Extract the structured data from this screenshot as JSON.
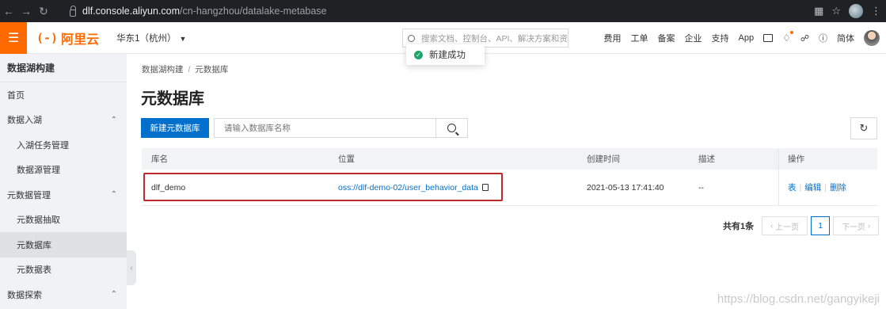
{
  "browser": {
    "domain": "dlf.console.aliyun.com",
    "path": "/cn-hangzhou/datalake-metabase",
    "icons": [
      "back-arrow-icon",
      "forward-arrow-icon",
      "reload-icon",
      "lock-icon",
      "qr-icon",
      "star-icon",
      "profile-icon",
      "menu-dots-icon"
    ]
  },
  "topbar": {
    "brand": "阿里云",
    "brand_mark": "(-)",
    "region": "华东1（杭州）",
    "search_placeholder": "搜索文档、控制台、API、解决方案和资",
    "nav": [
      "费用",
      "工单",
      "备案",
      "企业",
      "支持",
      "App"
    ],
    "lang": "简体",
    "accent_color": "#ff6a00"
  },
  "toast": {
    "message": "新建成功",
    "status_color": "#1ea56b"
  },
  "sidebar": {
    "title": "数据湖构建",
    "items": [
      {
        "label": "首页",
        "level": 0
      },
      {
        "label": "数据入湖",
        "level": 0,
        "expanded": true
      },
      {
        "label": "入湖任务管理",
        "level": 1
      },
      {
        "label": "数据源管理",
        "level": 1
      },
      {
        "label": "元数据管理",
        "level": 0,
        "expanded": true
      },
      {
        "label": "元数据抽取",
        "level": 1
      },
      {
        "label": "元数据库",
        "level": 1,
        "active": true
      },
      {
        "label": "元数据表",
        "level": 1
      },
      {
        "label": "数据探索",
        "level": 0,
        "expanded": true
      }
    ]
  },
  "main": {
    "breadcrumb": [
      "数据湖构建",
      "元数据库"
    ],
    "breadcrumb_sep": "/",
    "title": "元数据库",
    "new_button": "新建元数据库",
    "search_placeholder": "请输入数据库名称",
    "table": {
      "headers": [
        "库名",
        "位置",
        "创建时间",
        "描述",
        "操作"
      ],
      "rows": [
        {
          "name": "dlf_demo",
          "location": "oss://dlf-demo-02/user_behavior_data",
          "created": "2021-05-13 17:41:40",
          "description": "--",
          "actions": [
            "表",
            "编辑",
            "删除"
          ]
        }
      ]
    },
    "pagination": {
      "total": "共有1条",
      "prev": "上一页",
      "current": "1",
      "next": "下一页"
    },
    "link_color": "#0070cc",
    "highlight_color": "#c0292b"
  },
  "watermark": "https://blog.csdn.net/gangyikeji"
}
